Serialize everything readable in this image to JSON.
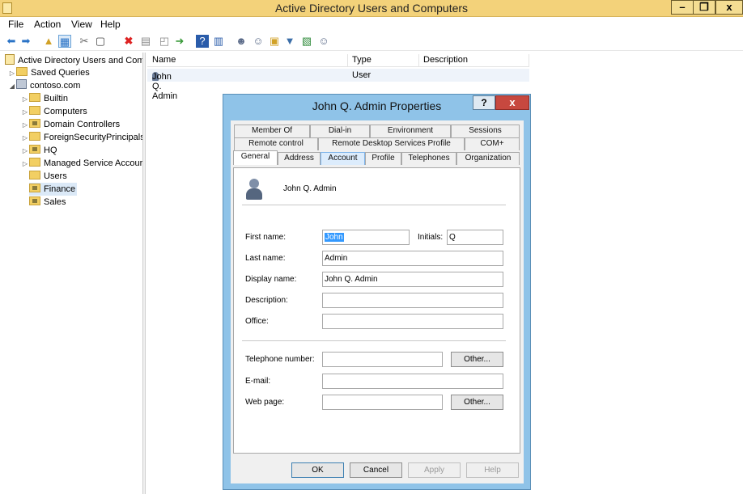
{
  "window": {
    "title": "Active Directory Users and Computers",
    "minimize": "–",
    "restore": "❐",
    "close": "x"
  },
  "menu": [
    "File",
    "Action",
    "View",
    "Help"
  ],
  "tree": {
    "root": "Active Directory Users and Com",
    "items": [
      {
        "label": "Saved Queries"
      },
      {
        "label": "contoso.com"
      },
      {
        "label": "Builtin"
      },
      {
        "label": "Computers"
      },
      {
        "label": "Domain Controllers"
      },
      {
        "label": "ForeignSecurityPrincipals"
      },
      {
        "label": "HQ"
      },
      {
        "label": "Managed Service Accour"
      },
      {
        "label": "Users"
      },
      {
        "label": "Finance"
      },
      {
        "label": "Sales"
      }
    ]
  },
  "list": {
    "columns": [
      "Name",
      "Type",
      "Description"
    ],
    "rows": [
      {
        "name": "John Q. Admin",
        "type": "User",
        "description": ""
      }
    ]
  },
  "dialog": {
    "title": "John Q. Admin Properties",
    "help": "?",
    "close": "x",
    "tabs_row1": [
      "Member Of",
      "Dial-in",
      "Environment",
      "Sessions"
    ],
    "tabs_row2": [
      "Remote control",
      "Remote Desktop Services Profile",
      "COM+"
    ],
    "tabs_row3": [
      "General",
      "Address",
      "Account",
      "Profile",
      "Telephones",
      "Organization"
    ],
    "active_tab": "General",
    "user_display": "John Q. Admin",
    "labels": {
      "first_name": "First name:",
      "initials": "Initials:",
      "last_name": "Last name:",
      "display_name": "Display name:",
      "description": "Description:",
      "office": "Office:",
      "telephone": "Telephone number:",
      "email": "E-mail:",
      "web_page": "Web page:"
    },
    "values": {
      "first_name": "John",
      "initials": "Q",
      "last_name": "Admin",
      "display_name": "John Q. Admin",
      "description": "",
      "office": "",
      "telephone": "",
      "email": "",
      "web_page": ""
    },
    "buttons": {
      "other1": "Other...",
      "other2": "Other...",
      "ok": "OK",
      "cancel": "Cancel",
      "apply": "Apply",
      "help": "Help"
    }
  }
}
